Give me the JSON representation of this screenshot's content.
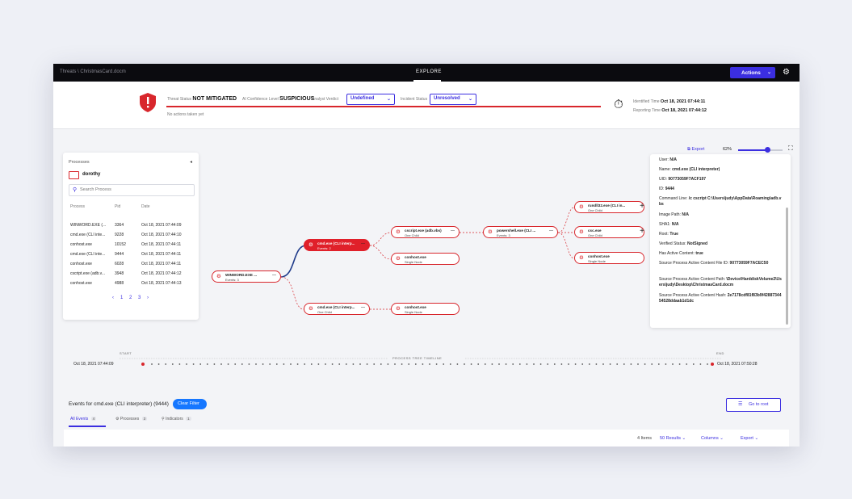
{
  "topbar": {
    "breadcrumb": "Threats \\ ChristmasCard.docm",
    "tabs": [
      "",
      "EXPLORE",
      ""
    ],
    "actions_label": "Actions",
    "actions_caret": "⌄",
    "gear_icon": "gear-icon"
  },
  "status": {
    "threat_status_label": "Threat Status",
    "threat_status_value": "NOT MITIGATED",
    "ai_conf_label": "AI Confidence Level",
    "ai_conf_value": "SUSPICIOUS",
    "analyst_verdict_label": "Analyst Verdict",
    "analyst_verdict_value": "Undefined",
    "incident_status_label": "Incident Status",
    "incident_status_value": "Unresolved",
    "no_actions": "No actions taken yet",
    "identified_label": "Identified Time",
    "identified_value": "Oct 18, 2021 07:44:11",
    "reporting_label": "Reporting Time",
    "reporting_value": "Oct 18, 2021 07:44:12",
    "accent": "#d8262c",
    "brand": "#3b2ee0"
  },
  "processes": {
    "title": "Processes",
    "collapse": "◂",
    "user": "dorothy",
    "search_placeholder": "Search Process",
    "headers": [
      "Process",
      "Pid",
      "Date"
    ],
    "rows": [
      {
        "process": "WINWORD.EXE (...",
        "pid": "3364",
        "date": "Oct 18, 2021 07:44:09"
      },
      {
        "process": "cmd.exe (CLI inte...",
        "pid": "9228",
        "date": "Oct 18, 2021 07:44:10"
      },
      {
        "process": "conhost.exe",
        "pid": "10152",
        "date": "Oct 18, 2021 07:44:11"
      },
      {
        "process": "cmd.exe (CLI inte...",
        "pid": "9444",
        "date": "Oct 18, 2021 07:44:11"
      },
      {
        "process": "conhost.exe",
        "pid": "6028",
        "date": "Oct 18, 2021 07:44:11"
      },
      {
        "process": "cscript.exe (adb.v...",
        "pid": "3948",
        "date": "Oct 18, 2021 07:44:12"
      },
      {
        "process": "conhost.exe",
        "pid": "4988",
        "date": "Oct 18, 2021 07:44:13"
      }
    ],
    "pager": {
      "prev": "‹",
      "pages": [
        "1",
        "2",
        "3"
      ],
      "next": "›"
    }
  },
  "tree": {
    "nodes": {
      "winword": {
        "name": "WINWORD.EXE ...",
        "sub": "Events: 3"
      },
      "cmd_sel": {
        "name": "cmd.exe (CLI interp...",
        "sub": "Events: 2"
      },
      "cmd2": {
        "name": "cmd.exe (CLI interp...",
        "sub": "One Child"
      },
      "cscript": {
        "name": "cscript.exe (adb.vbs)",
        "sub": "One Child"
      },
      "conhost1": {
        "name": "conhost.exe",
        "sub": "Single Node"
      },
      "conhost2": {
        "name": "conhost.exe",
        "sub": "Single Node"
      },
      "powershell": {
        "name": "powershell.exe (CLI ...",
        "sub": "Events: 3"
      },
      "rundll": {
        "name": "rundll32.exe (CLI in...",
        "sub": "One Child"
      },
      "csc": {
        "name": "csc.exe",
        "sub": "One Child"
      },
      "conhost3": {
        "name": "conhost.exe",
        "sub": "Single Node"
      }
    },
    "collapse_marker": "—",
    "expand_marker": "+"
  },
  "toolbar": {
    "export_label": "Export",
    "zoom": "62%",
    "zoom_level": 0.62
  },
  "details": [
    {
      "label": "User:",
      "value": "N/A"
    },
    {
      "label": "Name:",
      "value": "cmd.exe (CLI interpreter)"
    },
    {
      "label": "UID:",
      "value": "90773059F7ACF197"
    },
    {
      "label": "ID:",
      "value": "9444"
    },
    {
      "label": "Command Line:",
      "value": "/c cscript C:\\Users\\judy\\AppData\\Roaming\\adb.vbs"
    },
    {
      "label": "Image Path:",
      "value": "N/A"
    },
    {
      "label": "SHA1:",
      "value": "N/A"
    },
    {
      "label": "Root:",
      "value": "True"
    },
    {
      "label": "Verified Status:",
      "value": "NotSigned"
    },
    {
      "label": "Has Active Content:",
      "value": "true"
    },
    {
      "label": "Source Process Active Content File ID:",
      "value": "90773059F7ACEC50"
    },
    {
      "label": "Source Process Active Content Path:",
      "value": "\\Device\\HarddiskVolume2\\Users\\judy\\Desktop\\ChristmasCard.docm"
    },
    {
      "label": "Source Process Active Content Hash:",
      "value": "2e7178cdf81f83b9f4288734454528ddaab1d1dc"
    }
  ],
  "timeline": {
    "start_label": "START",
    "end_label": "END",
    "title": "PROCESS TREE TIMELINE",
    "start_date": "Oct 18, 2021 07:44:09",
    "end_date": "Oct 18, 2021 07:50:28"
  },
  "events": {
    "title": "Events for cmd.exe (CLI interpreter) (9444)",
    "clear_filter": "Clear Filter",
    "go_to_root": "Go to root",
    "tabs": [
      {
        "label": "All Events",
        "count": "4"
      },
      {
        "label": "Processes",
        "count": "3"
      },
      {
        "label": "Indicators",
        "count": "1"
      }
    ],
    "items_count": "4 Items",
    "results": "50 Results",
    "columns": "Columns",
    "export": "Export",
    "caret": "⌄"
  }
}
